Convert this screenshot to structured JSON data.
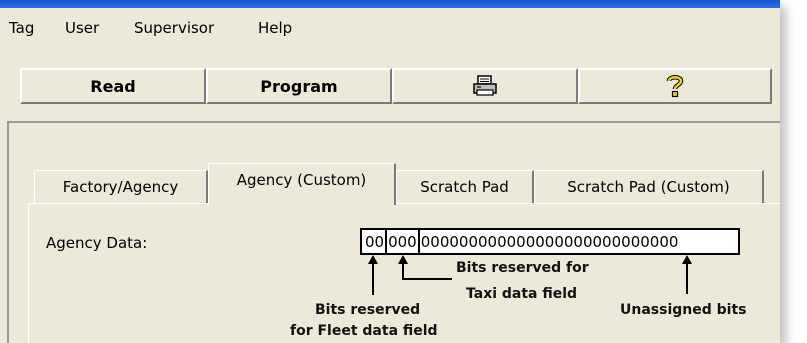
{
  "menu": {
    "items": [
      "Tag",
      "User",
      "Supervisor",
      "Help"
    ]
  },
  "toolbar": {
    "read_label": "Read",
    "program_label": "Program",
    "print_icon": "printer-icon",
    "help_icon": "question-mark-icon"
  },
  "tabs": [
    {
      "label": "Factory/Agency",
      "active": false
    },
    {
      "label": "Agency (Custom)",
      "active": true
    },
    {
      "label": "Scratch Pad",
      "active": false
    },
    {
      "label": "Scratch Pad (Custom)",
      "active": false
    }
  ],
  "agency": {
    "label": "Agency Data:",
    "fleet_bits": "00",
    "taxi_bits": "000",
    "unassigned_bits": "000000000000000000000000000"
  },
  "annotations": {
    "taxi_line1": "Bits reserved for",
    "taxi_line2": "Taxi data field",
    "fleet_line1": "Bits reserved",
    "fleet_line2": "for Fleet data field",
    "unassigned": "Unassigned bits"
  },
  "colors": {
    "window_bg": "#ece9d8",
    "title_strip": "#2a6bf0"
  }
}
